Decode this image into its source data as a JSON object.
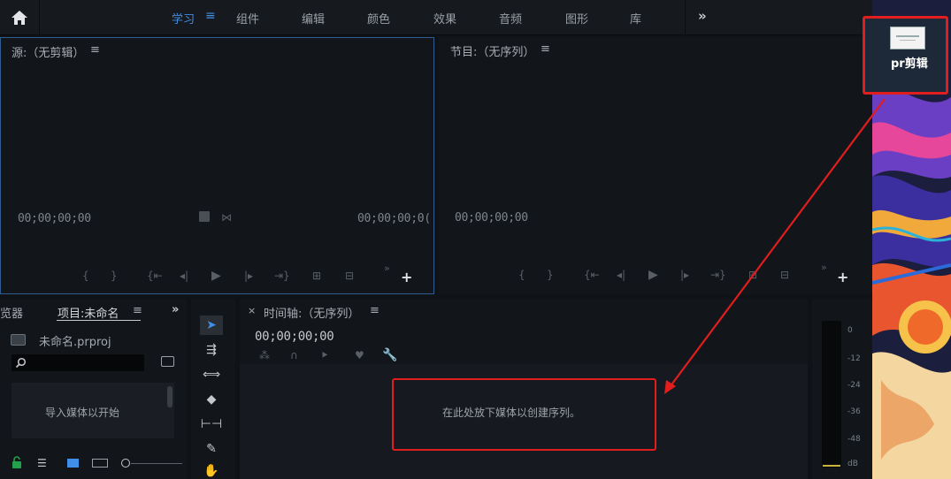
{
  "topbar": {
    "tabs": [
      "学习",
      "组件",
      "编辑",
      "颜色",
      "效果",
      "音频",
      "图形",
      "库"
    ],
    "menu_glyph": "≡",
    "more_glyph": "»"
  },
  "source": {
    "title": "源:（无剪辑）",
    "menu": "≡",
    "tc_left": "00;00;00;00",
    "tc_right": "00;00;00;0("
  },
  "program": {
    "title": "节目:（无序列）",
    "menu": "≡",
    "tc_left": "00;00;00;00"
  },
  "project": {
    "tab_left": "览器",
    "tab_active": "项目:未命名",
    "menu": "≡",
    "more": "»",
    "file": "未命名.prproj",
    "import_hint": "导入媒体以开始"
  },
  "timeline": {
    "close": "×",
    "title": "时间轴:（无序列）",
    "menu": "≡",
    "tc": "00;00;00;00",
    "drop_hint": "在此处放下媒体以创建序列。"
  },
  "meter": {
    "labels": [
      "0",
      "-12",
      "-24",
      "-36",
      "-48",
      "dB"
    ]
  },
  "desktop": {
    "app_label": "pr剪辑"
  },
  "colors": {
    "accent": "#3f8ee8",
    "highlight": "#e11d1d",
    "panel": "#12161b"
  }
}
